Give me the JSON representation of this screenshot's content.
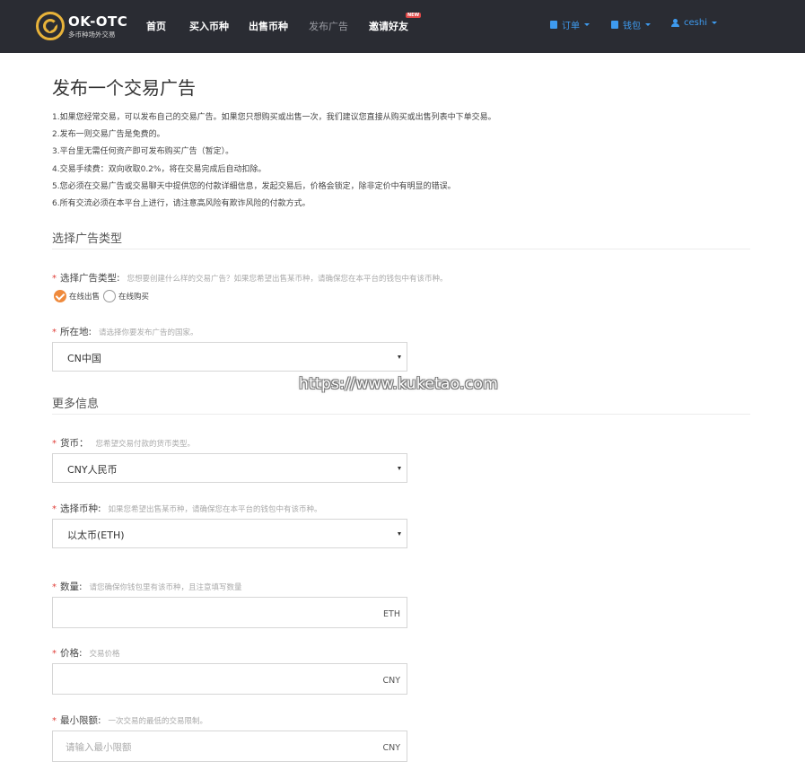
{
  "navbar": {
    "logo_title": "OK-OTC",
    "logo_subtitle": "多币种场外交易",
    "links": [
      "首页",
      "买入币种",
      "出售币种",
      "发布广告",
      "邀请好友"
    ],
    "new_badge": "NEW",
    "orders_label": "订单",
    "wallet_label": "钱包",
    "user_label": "ceshi"
  },
  "page": {
    "title": "发布一个交易广告",
    "notes": [
      "1.如果您经常交易，可以发布自己的交易广告。如果您只想购买或出售一次，我们建议您直接从购买或出售列表中下单交易。",
      "2.发布一则交易广告是免费的。",
      "3.平台里无需任何资产即可发布购买广告（暂定）。",
      "4.交易手续费：双向收取0.2%，将在交易完成后自动扣除。",
      "5.您必须在交易广告或交易聊天中提供您的付款详细信息，发起交易后，价格会锁定，除非定价中有明显的错误。",
      "6.所有交流必须在本平台上进行，请注意高风险有欺诈风险的付款方式。"
    ]
  },
  "section_type": {
    "title": "选择广告类型",
    "type_label": "选择广告类型:",
    "type_hint": "您想要创建什么样的交易广告？如果您希望出售某币种，请确保您在本平台的钱包中有该币种。",
    "option_sell": "在线出售",
    "option_buy": "在线购买",
    "location_label": "所在地:",
    "location_hint": "请选择你要发布广告的国家。",
    "location_value": "CN中国"
  },
  "section_more": {
    "title": "更多信息",
    "currency_label": "货币：",
    "currency_hint": "您希望交易付款的货币类型。",
    "currency_value": "CNY人民币",
    "coin_label": "选择币种:",
    "coin_hint": "如果您希望出售某币种，请确保您在本平台的钱包中有该币种。",
    "coin_value": "以太币(ETH)",
    "amount_label": "数量:",
    "amount_hint": "请您确保你钱包里有该币种，且注意填写数量",
    "amount_unit": "ETH",
    "price_label": "价格:",
    "price_hint": "交易价格",
    "price_unit": "CNY",
    "min_label": "最小限额:",
    "min_hint": "一次交易的最低的交易限制。",
    "min_placeholder": "请输入最小限额",
    "min_unit": "CNY"
  },
  "watermark": "https://www.kuketao.com",
  "colors": {
    "navbar_bg": "#2a2c33",
    "brand_gold": "#e8b33a",
    "nav_accent": "#3e9bf0",
    "required_star": "#e0403a",
    "radio_checked": "#ef8a3c"
  },
  "icons": [
    "logo-mark-icon",
    "clipboard-icon",
    "wallet-icon",
    "user-icon",
    "chevron-down-icon",
    "check-icon"
  ]
}
